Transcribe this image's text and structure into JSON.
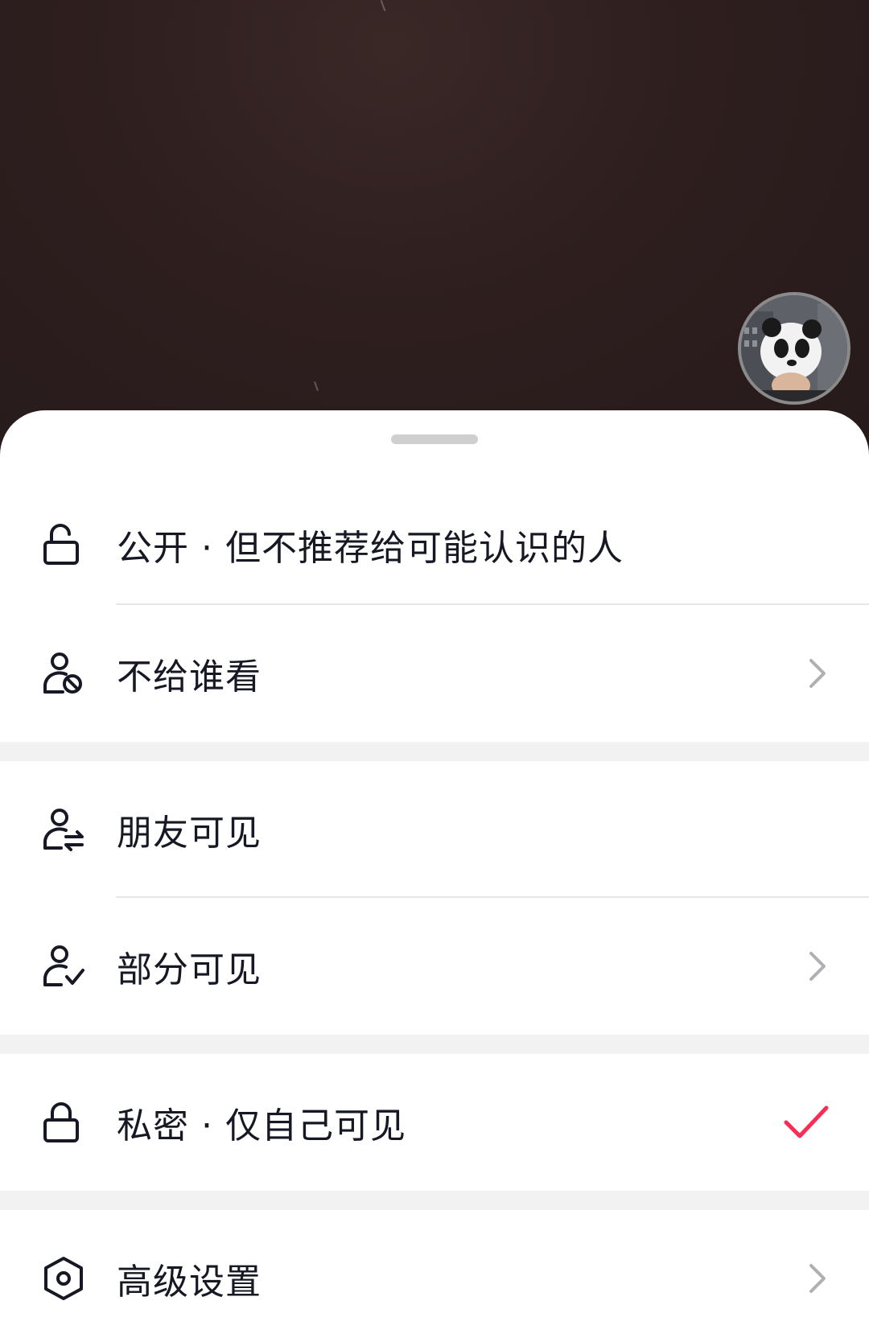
{
  "sheet": {
    "options": [
      {
        "label": "公开 · 但不推荐给可能认识的人",
        "icon": "unlock-icon",
        "has_chevron": false,
        "selected": false
      },
      {
        "label": "不给谁看",
        "icon": "user-block-icon",
        "has_chevron": true,
        "selected": false
      },
      {
        "label": "朋友可见",
        "icon": "user-friends-icon",
        "has_chevron": false,
        "selected": false
      },
      {
        "label": "部分可见",
        "icon": "user-check-icon",
        "has_chevron": true,
        "selected": false
      },
      {
        "label": "私密 · 仅自己可见",
        "icon": "lock-icon",
        "has_chevron": false,
        "selected": true
      },
      {
        "label": "高级设置",
        "icon": "hexagon-settings-icon",
        "has_chevron": true,
        "selected": false
      }
    ]
  },
  "colors": {
    "check_accent": "#fe2c55",
    "text_primary": "#161823",
    "section_gap": "#f2f2f2"
  }
}
